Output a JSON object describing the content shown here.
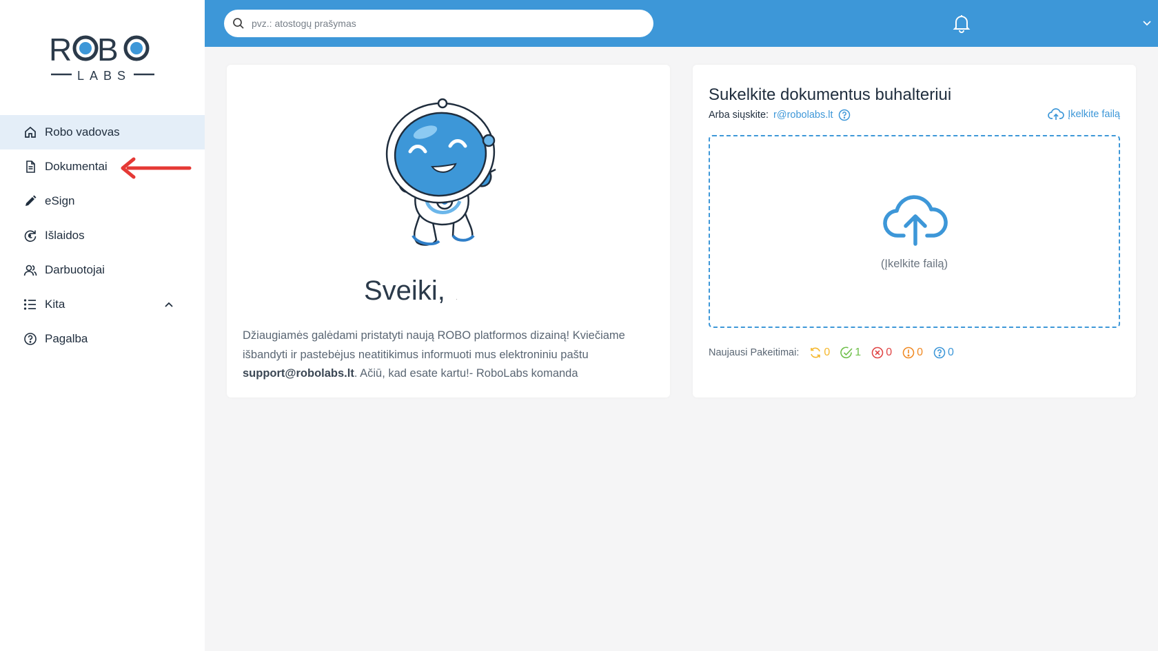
{
  "brand": {
    "logo_text": "ROBO",
    "logo_sub": "LABS",
    "accent": "#3d97d8"
  },
  "search": {
    "placeholder": "pvz.: atostogų prašymas",
    "value": ""
  },
  "sidebar": {
    "items": [
      {
        "label": "Robo vadovas",
        "icon": "home-icon",
        "active": true
      },
      {
        "label": "Dokumentai",
        "icon": "document-icon"
      },
      {
        "label": "eSign",
        "icon": "pen-icon"
      },
      {
        "label": "Išlaidos",
        "icon": "euro-refresh-icon"
      },
      {
        "label": "Darbuotojai",
        "icon": "users-icon"
      },
      {
        "label": "Kita",
        "icon": "list-icon",
        "expanded": true
      },
      {
        "label": "Pagalba",
        "icon": "help-circle-icon"
      }
    ]
  },
  "welcome": {
    "greeting": "Sveiki,",
    "greeting_suffix": ".",
    "text_part1": "Džiaugiamės galėdami pristatyti naują ROBO platformos dizainą! Kviečiame išbandyti ir pastebėjus neatitikimus informuoti mus elektroniniu paštu ",
    "support_email": "support@robolabs.lt",
    "text_part2": ". Ačiū, kad esate kartu!- RoboLabs komanda"
  },
  "upload": {
    "title": "Sukelkite dokumentus buhalteriui",
    "send_label": "Arba siųskite:",
    "send_email": "r@robolabs.lt",
    "upload_link": "Įkelkite failą",
    "dropzone_label": "(Įkelkite failą)",
    "changes_label": "Naujausi Pakeitimai:",
    "stats": [
      {
        "icon": "processing-icon",
        "value": "0",
        "color": "#f5b82e"
      },
      {
        "icon": "check-circle-icon",
        "value": "1",
        "color": "#6fbf4a"
      },
      {
        "icon": "x-circle-icon",
        "value": "0",
        "color": "#e04545"
      },
      {
        "icon": "alert-circle-icon",
        "value": "0",
        "color": "#f08a24"
      },
      {
        "icon": "question-circle-icon",
        "value": "0",
        "color": "#3d97d8"
      }
    ]
  }
}
